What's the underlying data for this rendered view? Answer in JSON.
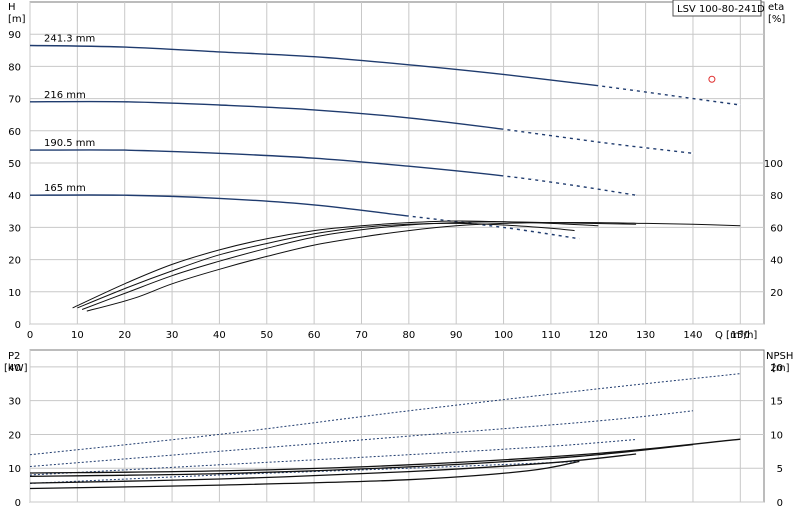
{
  "chart_data": [
    {
      "type": "line",
      "title": "LSV 100-80-241D",
      "ylabel": "H",
      "ylabel_unit": "[m]",
      "ylabel_right": "eta",
      "ylabel_right_unit": "[%]",
      "xlabel": "Q [m³/h]",
      "xlim": [
        0,
        155
      ],
      "ylim": [
        0,
        100
      ],
      "x_ticks": [
        0,
        10,
        20,
        30,
        40,
        50,
        60,
        70,
        80,
        90,
        100,
        110,
        120,
        130,
        140,
        150
      ],
      "y_ticks": [
        0,
        10,
        20,
        30,
        40,
        50,
        60,
        70,
        80,
        90
      ],
      "right_ticks": [
        20,
        40,
        60,
        80,
        100
      ],
      "grid": true,
      "marker": {
        "x": 144,
        "y": 76,
        "color": "#e03030"
      },
      "series": [
        {
          "name": "241.3 mm",
          "kind": "head",
          "color": "#1f3b6e",
          "x": [
            0,
            20,
            40,
            60,
            80,
            100,
            120,
            140,
            150
          ],
          "y": [
            86.5,
            86,
            84.5,
            83,
            80.5,
            77.5,
            74,
            70,
            68
          ]
        },
        {
          "name": "216 mm",
          "kind": "head",
          "color": "#1f3b6e",
          "x": [
            0,
            20,
            40,
            60,
            80,
            100,
            120,
            140
          ],
          "y": [
            69,
            69,
            68,
            66.5,
            64,
            60.5,
            56.5,
            53
          ]
        },
        {
          "name": "190.5 mm",
          "kind": "head",
          "color": "#1f3b6e",
          "x": [
            0,
            20,
            40,
            60,
            80,
            100,
            115,
            128
          ],
          "y": [
            54,
            54,
            53,
            51.5,
            49,
            46,
            43,
            40
          ]
        },
        {
          "name": "165 mm",
          "kind": "head",
          "color": "#1f3b6e",
          "x": [
            0,
            20,
            40,
            60,
            80,
            100,
            116
          ],
          "y": [
            40,
            40,
            39,
            37,
            33.5,
            30,
            26.5
          ]
        },
        {
          "kind": "eta",
          "color": "#111111",
          "x": [
            9,
            20,
            30,
            40,
            50,
            60,
            70,
            80,
            90,
            100,
            110,
            120
          ],
          "y": [
            10,
            25,
            37,
            46,
            53,
            58,
            61,
            63,
            64,
            63.5,
            62.5,
            61
          ]
        },
        {
          "kind": "eta",
          "color": "#111111",
          "x": [
            10,
            20,
            30,
            40,
            50,
            60,
            70,
            80,
            90,
            100,
            110,
            115
          ],
          "y": [
            10,
            22,
            33,
            43,
            50,
            56,
            60,
            62,
            62.5,
            61.5,
            59.5,
            58
          ]
        },
        {
          "kind": "eta",
          "color": "#111111",
          "x": [
            11,
            20,
            30,
            40,
            50,
            60,
            70,
            80,
            90,
            100,
            110,
            128
          ],
          "y": [
            9,
            19,
            30,
            39,
            47,
            54,
            58.5,
            61.5,
            63,
            63.5,
            63,
            62
          ]
        },
        {
          "kind": "eta",
          "color": "#111111",
          "x": [
            12,
            22,
            30,
            40,
            50,
            60,
            70,
            80,
            90,
            100,
            110,
            120,
            130,
            140,
            150
          ],
          "y": [
            8,
            16,
            25,
            34,
            42,
            49,
            54,
            58,
            61,
            62.5,
            63,
            63,
            62.5,
            62,
            61
          ]
        }
      ]
    },
    {
      "type": "line",
      "ylabel": "P2",
      "ylabel_unit": "[kW]",
      "ylabel_right": "NPSH",
      "ylabel_right_unit": "[m]",
      "xlim": [
        0,
        155
      ],
      "ylim": [
        0,
        45
      ],
      "y_ticks": [
        0,
        10,
        20,
        30,
        40
      ],
      "right_ticks": [
        0,
        5,
        10,
        15,
        20
      ],
      "grid": true,
      "series": [
        {
          "kind": "power",
          "color": "#1f3b6e",
          "x": [
            0,
            40,
            80,
            120,
            150
          ],
          "y": [
            14,
            20,
            27,
            33.5,
            38
          ]
        },
        {
          "kind": "power",
          "color": "#1f3b6e",
          "x": [
            0,
            40,
            80,
            120,
            140
          ],
          "y": [
            10.5,
            15,
            19.5,
            24,
            27
          ]
        },
        {
          "kind": "power",
          "color": "#1f3b6e",
          "x": [
            0,
            40,
            80,
            110,
            128
          ],
          "y": [
            8,
            11,
            14,
            16.5,
            18.5
          ]
        },
        {
          "kind": "power",
          "color": "#1f3b6e",
          "x": [
            0,
            40,
            80,
            116
          ],
          "y": [
            5.5,
            8,
            10,
            12
          ]
        },
        {
          "kind": "npsh",
          "color": "#111111",
          "x": [
            0,
            40,
            80,
            120,
            150
          ],
          "y": [
            4.3,
            4.6,
            5.5,
            7.2,
            9.3
          ]
        },
        {
          "kind": "npsh",
          "color": "#111111",
          "x": [
            0,
            40,
            80,
            115,
            140
          ],
          "y": [
            3.8,
            4.2,
            5.2,
            6.7,
            8.5
          ]
        },
        {
          "kind": "npsh",
          "color": "#111111",
          "x": [
            0,
            40,
            80,
            110,
            128
          ],
          "y": [
            2.8,
            3.4,
            4.5,
            5.8,
            7.1
          ]
        },
        {
          "kind": "npsh",
          "color": "#111111",
          "x": [
            0,
            40,
            80,
            105,
            116
          ],
          "y": [
            2.0,
            2.5,
            3.3,
            4.6,
            6.0
          ]
        }
      ]
    }
  ]
}
